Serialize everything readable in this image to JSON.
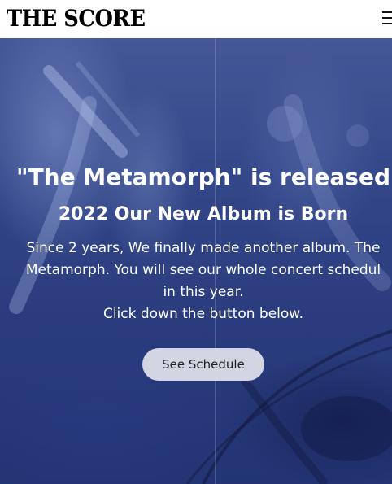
{
  "header": {
    "logo_text": "THE SCORE",
    "menu_icon": "hamburger-menu-icon"
  },
  "hero": {
    "title": "\"The Metamorph\" is released",
    "subtitle": "2022 Our New Album is Born",
    "description_lines": [
      "Since 2 years, We finally made another album. The",
      "Metamorph. You will see our whole concert schedul",
      "in this year.",
      "Click down the button below."
    ],
    "button_label": "See Schedule"
  },
  "colors": {
    "header_bg": "#ffffff",
    "hero_bg": "#34488a",
    "button_bg": "#d3d6e2",
    "text_light": "#ffffff"
  }
}
